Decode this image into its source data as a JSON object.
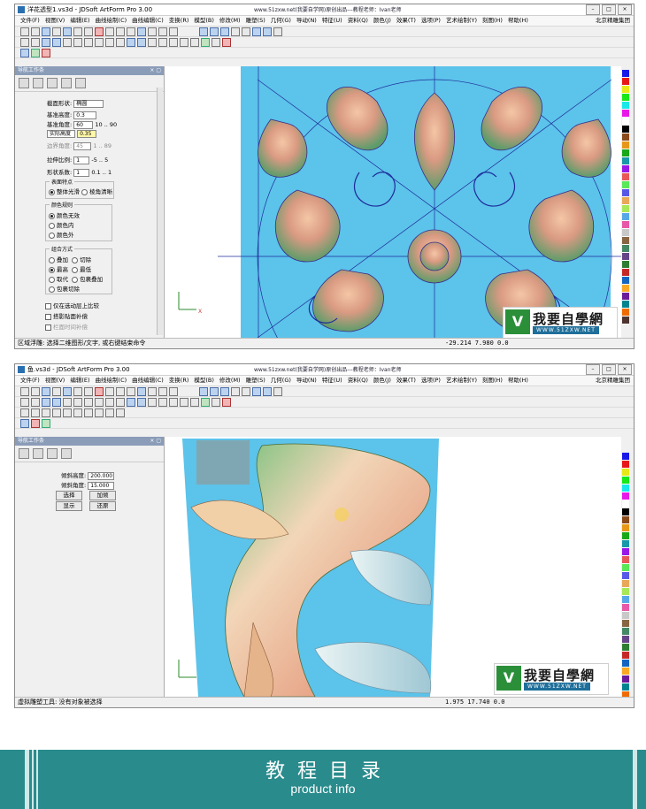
{
  "window1": {
    "title": "洋花透型1.vs3d - JDSoft ArtForm Pro 3.00",
    "center_caption": "www.51zxw.net(我要自学网)原创出品---教程老师：Ivan老师",
    "menu": [
      "文件(F)",
      "视图(V)",
      "编辑(E)",
      "曲线绘制(C)",
      "曲线编辑(C)",
      "变换(R)",
      "模型(B)",
      "修改(M)",
      "雕塑(S)",
      "几何(G)",
      "导动(N)",
      "特征(U)",
      "资料(Q)",
      "颜色(J)",
      "效果(T)",
      "选项(P)",
      "艺术绘制(Y)",
      "刻图(H)",
      "帮助(H)"
    ],
    "menu_right": "北京精雕集团",
    "panel_title": "导航工作条",
    "form": {
      "section_shape_label": "截面形状:",
      "section_shape_value": "椭圆",
      "base_height_label": "基准高度:",
      "base_height_value": "0.3",
      "base_angle_label": "基准角度:",
      "base_angle_value": "60",
      "base_angle_range": "10 .. 90",
      "actual_height_label": "实际高度",
      "actual_height_value": "0.35",
      "edge_angle_label": "边界角度:",
      "edge_angle_value": "45",
      "edge_angle_range": "1 .. 89",
      "stretch_label": "拉伸比例:",
      "stretch_value": "1",
      "stretch_range": "-5 .. 5",
      "shape_coef_label": "形状系数:",
      "shape_coef_value": "1",
      "shape_coef_range": "0.1 .. 1",
      "surface_group": "表面特点",
      "surface_opt1": "整体光滑",
      "surface_opt2": "棱角清晰",
      "color_group": "颜色规则",
      "color_opt1": "颜色无效",
      "color_opt2": "颜色内",
      "color_opt3": "颜色外",
      "combine_group": "组合方式",
      "combine_opts": [
        "叠加",
        "切除",
        "最高",
        "最低",
        "取代",
        "包裹叠加",
        "包裹切除"
      ],
      "check1": "仅在选动层上比较",
      "check2": "搭影贴面补偿",
      "check3": "栏面时间补偿"
    },
    "status_text": "区域浮雕: 选择二维图形/文字, 或右键结束命令",
    "coords": "-29.214 7.980 0.0"
  },
  "window2": {
    "title": "鱼.vs3d - JDSoft ArtForm Pro 3.00",
    "center_caption": "www.51zxw.net(我要自学网)原创出品---教程老师：Ivan老师",
    "menu": [
      "文件(F)",
      "视图(V)",
      "编辑(E)",
      "曲线绘制(C)",
      "曲线编辑(C)",
      "变换(R)",
      "模型(B)",
      "修改(M)",
      "雕塑(S)",
      "几何(G)",
      "导动(N)",
      "特征(U)",
      "资料(Q)",
      "颜色(J)",
      "效果(T)",
      "选项(P)",
      "艺术绘制(Y)",
      "刻图(H)",
      "帮助(H)"
    ],
    "menu_right": "北京精雕集团",
    "panel_title": "导航工作条",
    "form": {
      "tilt_height_label": "倾斜高度:",
      "tilt_height_value": "200.000",
      "tilt_angle_label": "倾斜角度:",
      "tilt_angle_value": "15.000",
      "btn_select": "选择",
      "btn_tilt": "加倾",
      "btn_show": "显示",
      "btn_restore": "还原"
    },
    "status_text": "虚拟雕塑工具: 没有对象被选择",
    "coords": "1.975 17.740 0.0"
  },
  "logo": {
    "mark": "V",
    "cn": "我要自學網",
    "url": "WWW.51ZXW.NET"
  },
  "footer": {
    "title": "教程目录",
    "subtitle": "product info"
  },
  "colors": {
    "viewport_bg": "#5cc3ea",
    "footer_bg": "#2a8b8c",
    "panel_header": "#8a9cb8"
  },
  "palette": [
    "#1818e8",
    "#e81818",
    "#e8e818",
    "#18e818",
    "#18e8e8",
    "#e818e8",
    "#ffffff",
    "#000000",
    "#8a4a1a",
    "#e89818",
    "#18a818",
    "#1898a8",
    "#9818e8",
    "#e85858",
    "#58e858",
    "#5858e8",
    "#e8a858",
    "#a8e858",
    "#58a8e8",
    "#e858a8",
    "#c8c8c8",
    "#886644",
    "#448866",
    "#664488",
    "#2e7d32",
    "#c62828",
    "#1565c0",
    "#f9a825",
    "#6a1b9a",
    "#00838f",
    "#ef6c00",
    "#4e342e"
  ]
}
